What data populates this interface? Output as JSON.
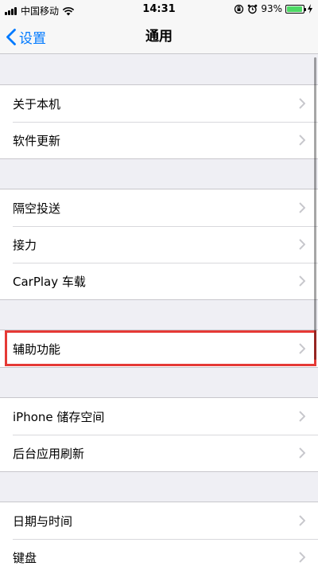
{
  "status_bar": {
    "carrier": "中国移动",
    "time": "14:31",
    "battery_percent": "93%",
    "battery_level": 0.93,
    "icons": [
      "signal-icon",
      "wifi-icon",
      "orientation-lock-icon",
      "alarm-icon",
      "battery-icon",
      "charging-bolt-icon"
    ]
  },
  "nav": {
    "back_label": "设置",
    "title": "通用"
  },
  "groups": [
    {
      "items": [
        {
          "label": "关于本机"
        },
        {
          "label": "软件更新"
        }
      ]
    },
    {
      "items": [
        {
          "label": "隔空投送"
        },
        {
          "label": "接力"
        },
        {
          "label": "CarPlay 车载"
        }
      ]
    },
    {
      "items": [
        {
          "label": "辅助功能"
        }
      ]
    },
    {
      "items": [
        {
          "label": "iPhone 储存空间"
        },
        {
          "label": "后台应用刷新"
        }
      ]
    },
    {
      "items": [
        {
          "label": "日期与时间"
        },
        {
          "label": "键盘"
        }
      ]
    }
  ],
  "colors": {
    "accent": "#007aff",
    "highlight": "#e53935",
    "background": "#efeff4",
    "battery": "#4cd964"
  }
}
